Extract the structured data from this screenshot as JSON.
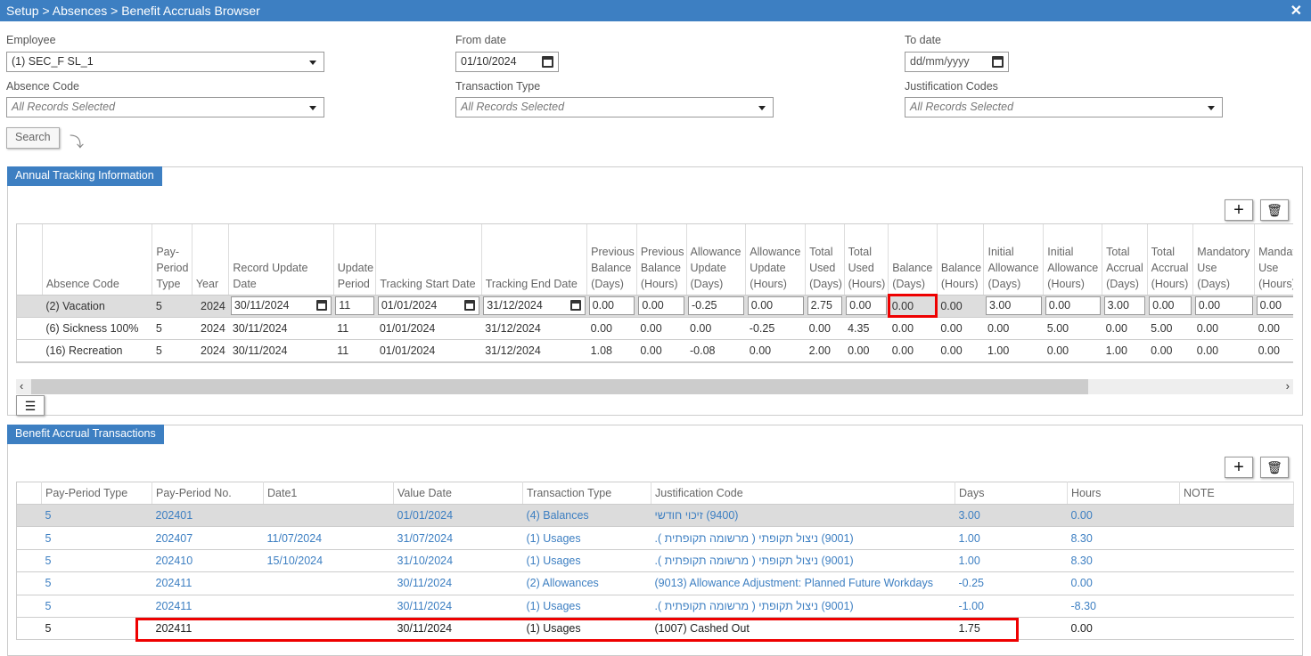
{
  "title": "Setup > Absences > Benefit Accruals Browser",
  "filters": {
    "employee": {
      "label": "Employee",
      "value": "(1) SEC_F SL_1"
    },
    "from_date": {
      "label": "From date",
      "value": "01/10/2024"
    },
    "to_date": {
      "label": "To date",
      "placeholder": "dd/mm/yyyy"
    },
    "absence_code": {
      "label": "Absence Code",
      "value": "All Records Selected"
    },
    "transaction_type": {
      "label": "Transaction Type",
      "value": "All Records Selected"
    },
    "justification_codes": {
      "label": "Justification Codes",
      "value": "All Records Selected"
    },
    "search_label": "Search"
  },
  "annual": {
    "tab": "Annual Tracking Information",
    "columns": [
      "Absence Code",
      "Pay-Period Type",
      "Year",
      "Record Update Date",
      "Update Period",
      "Tracking Start Date",
      "Tracking End Date",
      "Previous Balance (Days)",
      "Previous Balance (Hours)",
      "Allowance Update (Days)",
      "Allowance Update (Hours)",
      "Total Used (Days)",
      "Total Used (Hours)",
      "Balance (Days)",
      "Balance (Hours)",
      "Initial Allowance (Days)",
      "Initial Allowance (Hours)",
      "Total Accrual (Days)",
      "Total Accrual (Hours)",
      "Mandatory Use (Days)",
      "Mandatory Use (Hours)"
    ],
    "rows": [
      [
        "(2) Vacation",
        "5",
        "2024",
        "30/11/2024",
        "11",
        "01/01/2024",
        "31/12/2024",
        "0.00",
        "0.00",
        "-0.25",
        "0.00",
        "2.75",
        "0.00",
        "0.00",
        "0.00",
        "3.00",
        "0.00",
        "3.00",
        "0.00",
        "0.00",
        "0.00"
      ],
      [
        "(6) Sickness 100%",
        "5",
        "2024",
        "30/11/2024",
        "11",
        "01/01/2024",
        "31/12/2024",
        "0.00",
        "0.00",
        "0.00",
        "-0.25",
        "0.00",
        "4.35",
        "0.00",
        "0.00",
        "0.00",
        "5.00",
        "0.00",
        "5.00",
        "0.00",
        "0.00"
      ],
      [
        "(16) Recreation",
        "5",
        "2024",
        "30/11/2024",
        "11",
        "01/01/2024",
        "31/12/2024",
        "1.08",
        "0.00",
        "-0.08",
        "0.00",
        "2.00",
        "0.00",
        "0.00",
        "0.00",
        "1.00",
        "0.00",
        "1.00",
        "0.00",
        "0.00",
        "0.00"
      ]
    ]
  },
  "transactions": {
    "tab": "Benefit Accrual Transactions",
    "columns": [
      "Pay-Period Type",
      "Pay-Period No.",
      "Date1",
      "Value Date",
      "Transaction Type",
      "Justification Code",
      "Days",
      "Hours",
      "NOTE"
    ],
    "rows": [
      [
        "5",
        "202401",
        "",
        "01/01/2024",
        "(4) Balances",
        "(9400) זיכוי חודשי",
        "3.00",
        "0.00",
        ""
      ],
      [
        "5",
        "202407",
        "11/07/2024",
        "31/07/2024",
        "(1) Usages",
        "(9001) ניצול תקופתי ( מרשומה תקופתית ).",
        "1.00",
        "8.30",
        ""
      ],
      [
        "5",
        "202410",
        "15/10/2024",
        "31/10/2024",
        "(1) Usages",
        "(9001) ניצול תקופתי ( מרשומה תקופתית ).",
        "1.00",
        "8.30",
        ""
      ],
      [
        "5",
        "202411",
        "",
        "30/11/2024",
        "(2) Allowances",
        "(9013) Allowance Adjustment: Planned Future Workdays",
        "-0.25",
        "0.00",
        ""
      ],
      [
        "5",
        "202411",
        "",
        "30/11/2024",
        "(1) Usages",
        "(9001) ניצול תקופתי ( מרשומה תקופתית ).",
        "-1.00",
        "-8.30",
        ""
      ],
      [
        "5",
        "202411",
        "",
        "30/11/2024",
        "(1) Usages",
        "(1007) Cashed Out",
        "1.75",
        "0.00",
        ""
      ]
    ]
  },
  "colors": {
    "accent": "#3d7fc2",
    "highlight": "#e00000"
  }
}
